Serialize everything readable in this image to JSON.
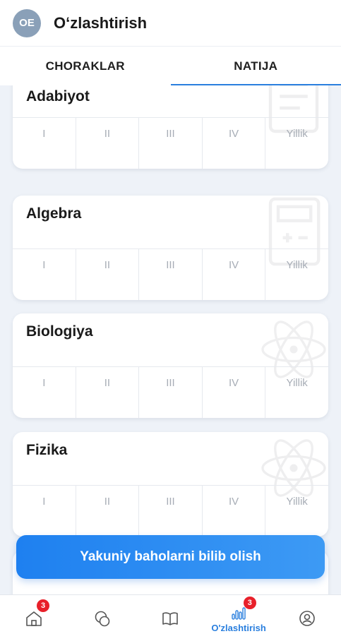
{
  "header": {
    "avatar_initials": "OE",
    "title": "O‘zlashtirish"
  },
  "tabs": [
    {
      "label": "CHORAKLAR",
      "active": false
    },
    {
      "label": "NATIJA",
      "active": true
    }
  ],
  "grade_columns": [
    "I",
    "II",
    "III",
    "IV",
    "Yillik"
  ],
  "subjects": [
    {
      "name": "Adabiyot"
    },
    {
      "name": "Algebra"
    },
    {
      "name": "Biologiya"
    },
    {
      "name": "Fizika"
    }
  ],
  "cta": {
    "label": "Yakuniy baholarni bilib olish"
  },
  "bottom_nav": [
    {
      "icon": "home-icon",
      "label": "",
      "badge": "3"
    },
    {
      "icon": "chat-icon",
      "label": "",
      "badge": ""
    },
    {
      "icon": "book-icon",
      "label": "",
      "badge": ""
    },
    {
      "icon": "chart-icon",
      "label": "O'zlashtirish",
      "badge": "3",
      "active": true
    },
    {
      "icon": "profile-icon",
      "label": "",
      "badge": ""
    }
  ],
  "colors": {
    "accent": "#2a7fde",
    "badge": "#e8202a",
    "background": "#eef2f8",
    "avatar": "#8aa0b8"
  }
}
